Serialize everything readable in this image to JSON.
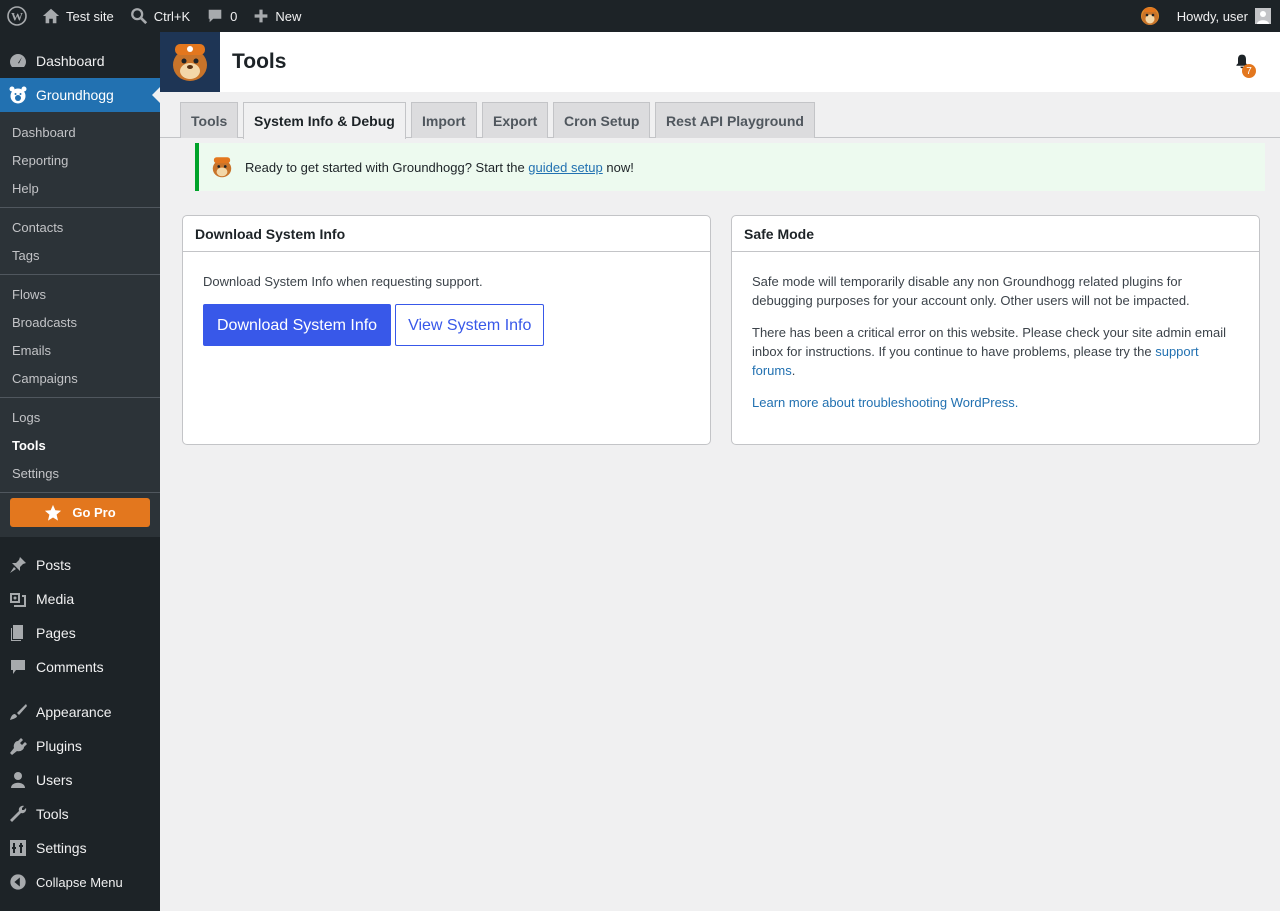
{
  "adminbar": {
    "site_name": "Test site",
    "search_shortcut": "Ctrl+K",
    "comments_count": "0",
    "new_label": "New",
    "greeting": "Howdy, user"
  },
  "sidebar": {
    "dashboard": "Dashboard",
    "groundhogg": "Groundhogg",
    "groundhogg_sub": {
      "group1": [
        "Dashboard",
        "Reporting",
        "Help"
      ],
      "group2": [
        "Contacts",
        "Tags"
      ],
      "group3": [
        "Flows",
        "Broadcasts",
        "Emails",
        "Campaigns"
      ],
      "group4": [
        "Logs",
        "Tools",
        "Settings"
      ],
      "go_pro": "Go Pro"
    },
    "posts": "Posts",
    "media": "Media",
    "pages": "Pages",
    "comments": "Comments",
    "appearance": "Appearance",
    "plugins": "Plugins",
    "users": "Users",
    "tools": "Tools",
    "settings": "Settings",
    "collapse": "Collapse Menu"
  },
  "header": {
    "title": "Tools",
    "notification_count": "7"
  },
  "tabs": [
    "Tools",
    "System Info & Debug",
    "Import",
    "Export",
    "Cron Setup",
    "Rest API Playground"
  ],
  "active_tab": "System Info & Debug",
  "notice": {
    "text_before": "Ready to get started with Groundhogg? Start the ",
    "link": "guided setup",
    "text_after": " now!"
  },
  "download_panel": {
    "title": "Download System Info",
    "description": "Download System Info when requesting support.",
    "primary_button": "Download System Info",
    "secondary_button": "View System Info"
  },
  "safe_mode_panel": {
    "title": "Safe Mode",
    "p1": "Safe mode will temporarily disable any non Groundhogg related plugins for debugging purposes for your account only. Other users will not be impacted.",
    "p2_before": "There has been a critical error on this website. Please check your site admin email inbox for instructions. If you continue to have problems, please try the ",
    "p2_link": "support forums",
    "p2_after": ".",
    "p3_link": "Learn more about troubleshooting WordPress."
  },
  "colors": {
    "adminbar_bg": "#1d2327",
    "accent": "#2271b1",
    "primary_button": "#3858e9",
    "go_pro": "#e3771e",
    "notice_border": "#00a32a"
  }
}
